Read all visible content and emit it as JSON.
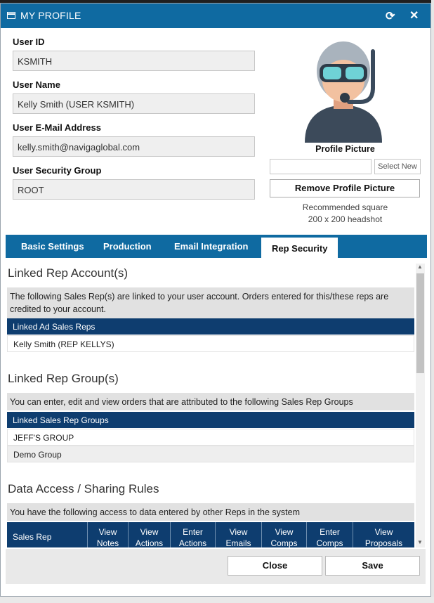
{
  "window": {
    "title": "MY PROFILE",
    "refresh_icon": "refresh-icon",
    "close_icon": "close-icon",
    "close_glyph": "✕",
    "refresh_glyph": "⟳"
  },
  "fields": [
    {
      "label": "User ID",
      "value": "KSMITH"
    },
    {
      "label": "User Name",
      "value": "Kelly Smith (USER KSMITH)"
    },
    {
      "label": "User E-Mail Address",
      "value": "kelly.smith@navigaglobal.com"
    },
    {
      "label": "User Security Group",
      "value": "ROOT"
    }
  ],
  "profile": {
    "picture_label": "Profile Picture",
    "select_new": "Select New",
    "remove_button": "Remove Profile Picture",
    "recommendation_line1": "Recommended square",
    "recommendation_line2": "200 x 200 headshot",
    "avatar_icon": "diver-avatar-icon"
  },
  "tabs": [
    {
      "label": "Basic Settings",
      "active": false
    },
    {
      "label": "Production",
      "active": false
    },
    {
      "label": "Email Integration",
      "active": false
    },
    {
      "label": "Rep Security",
      "active": true
    }
  ],
  "linked_rep_accounts": {
    "title": "Linked Rep Account(s)",
    "note": "The following Sales Rep(s) are linked to your user account. Orders entered for this/these reps are credited to your account.",
    "header": "Linked Ad Sales Reps",
    "rows": [
      "Kelly Smith (REP KELLYS)"
    ]
  },
  "linked_rep_groups": {
    "title": "Linked Rep Group(s)",
    "note": "You can enter, edit and view orders that are attributed to the following Sales Rep Groups",
    "header": "Linked Sales Rep Groups",
    "rows": [
      "JEFF'S GROUP",
      "Demo Group"
    ]
  },
  "data_access": {
    "title": "Data Access / Sharing Rules",
    "note": "You have the following access to data entered by other Reps in the system",
    "columns": [
      {
        "line1": "Sales Rep",
        "line2": ""
      },
      {
        "line1": "View",
        "line2": "Notes"
      },
      {
        "line1": "View",
        "line2": "Actions"
      },
      {
        "line1": "Enter",
        "line2": "Actions"
      },
      {
        "line1": "View",
        "line2": "Emails"
      },
      {
        "line1": "View",
        "line2": "Comps"
      },
      {
        "line1": "Enter",
        "line2": "Comps"
      },
      {
        "line1": "View",
        "line2": "Proposals"
      }
    ]
  },
  "footer": {
    "close_label": "Close",
    "save_label": "Save"
  },
  "colors": {
    "titlebar": "#0f6aa1",
    "table_header": "#0e3d6f",
    "note_background": "#e1e1e1"
  }
}
